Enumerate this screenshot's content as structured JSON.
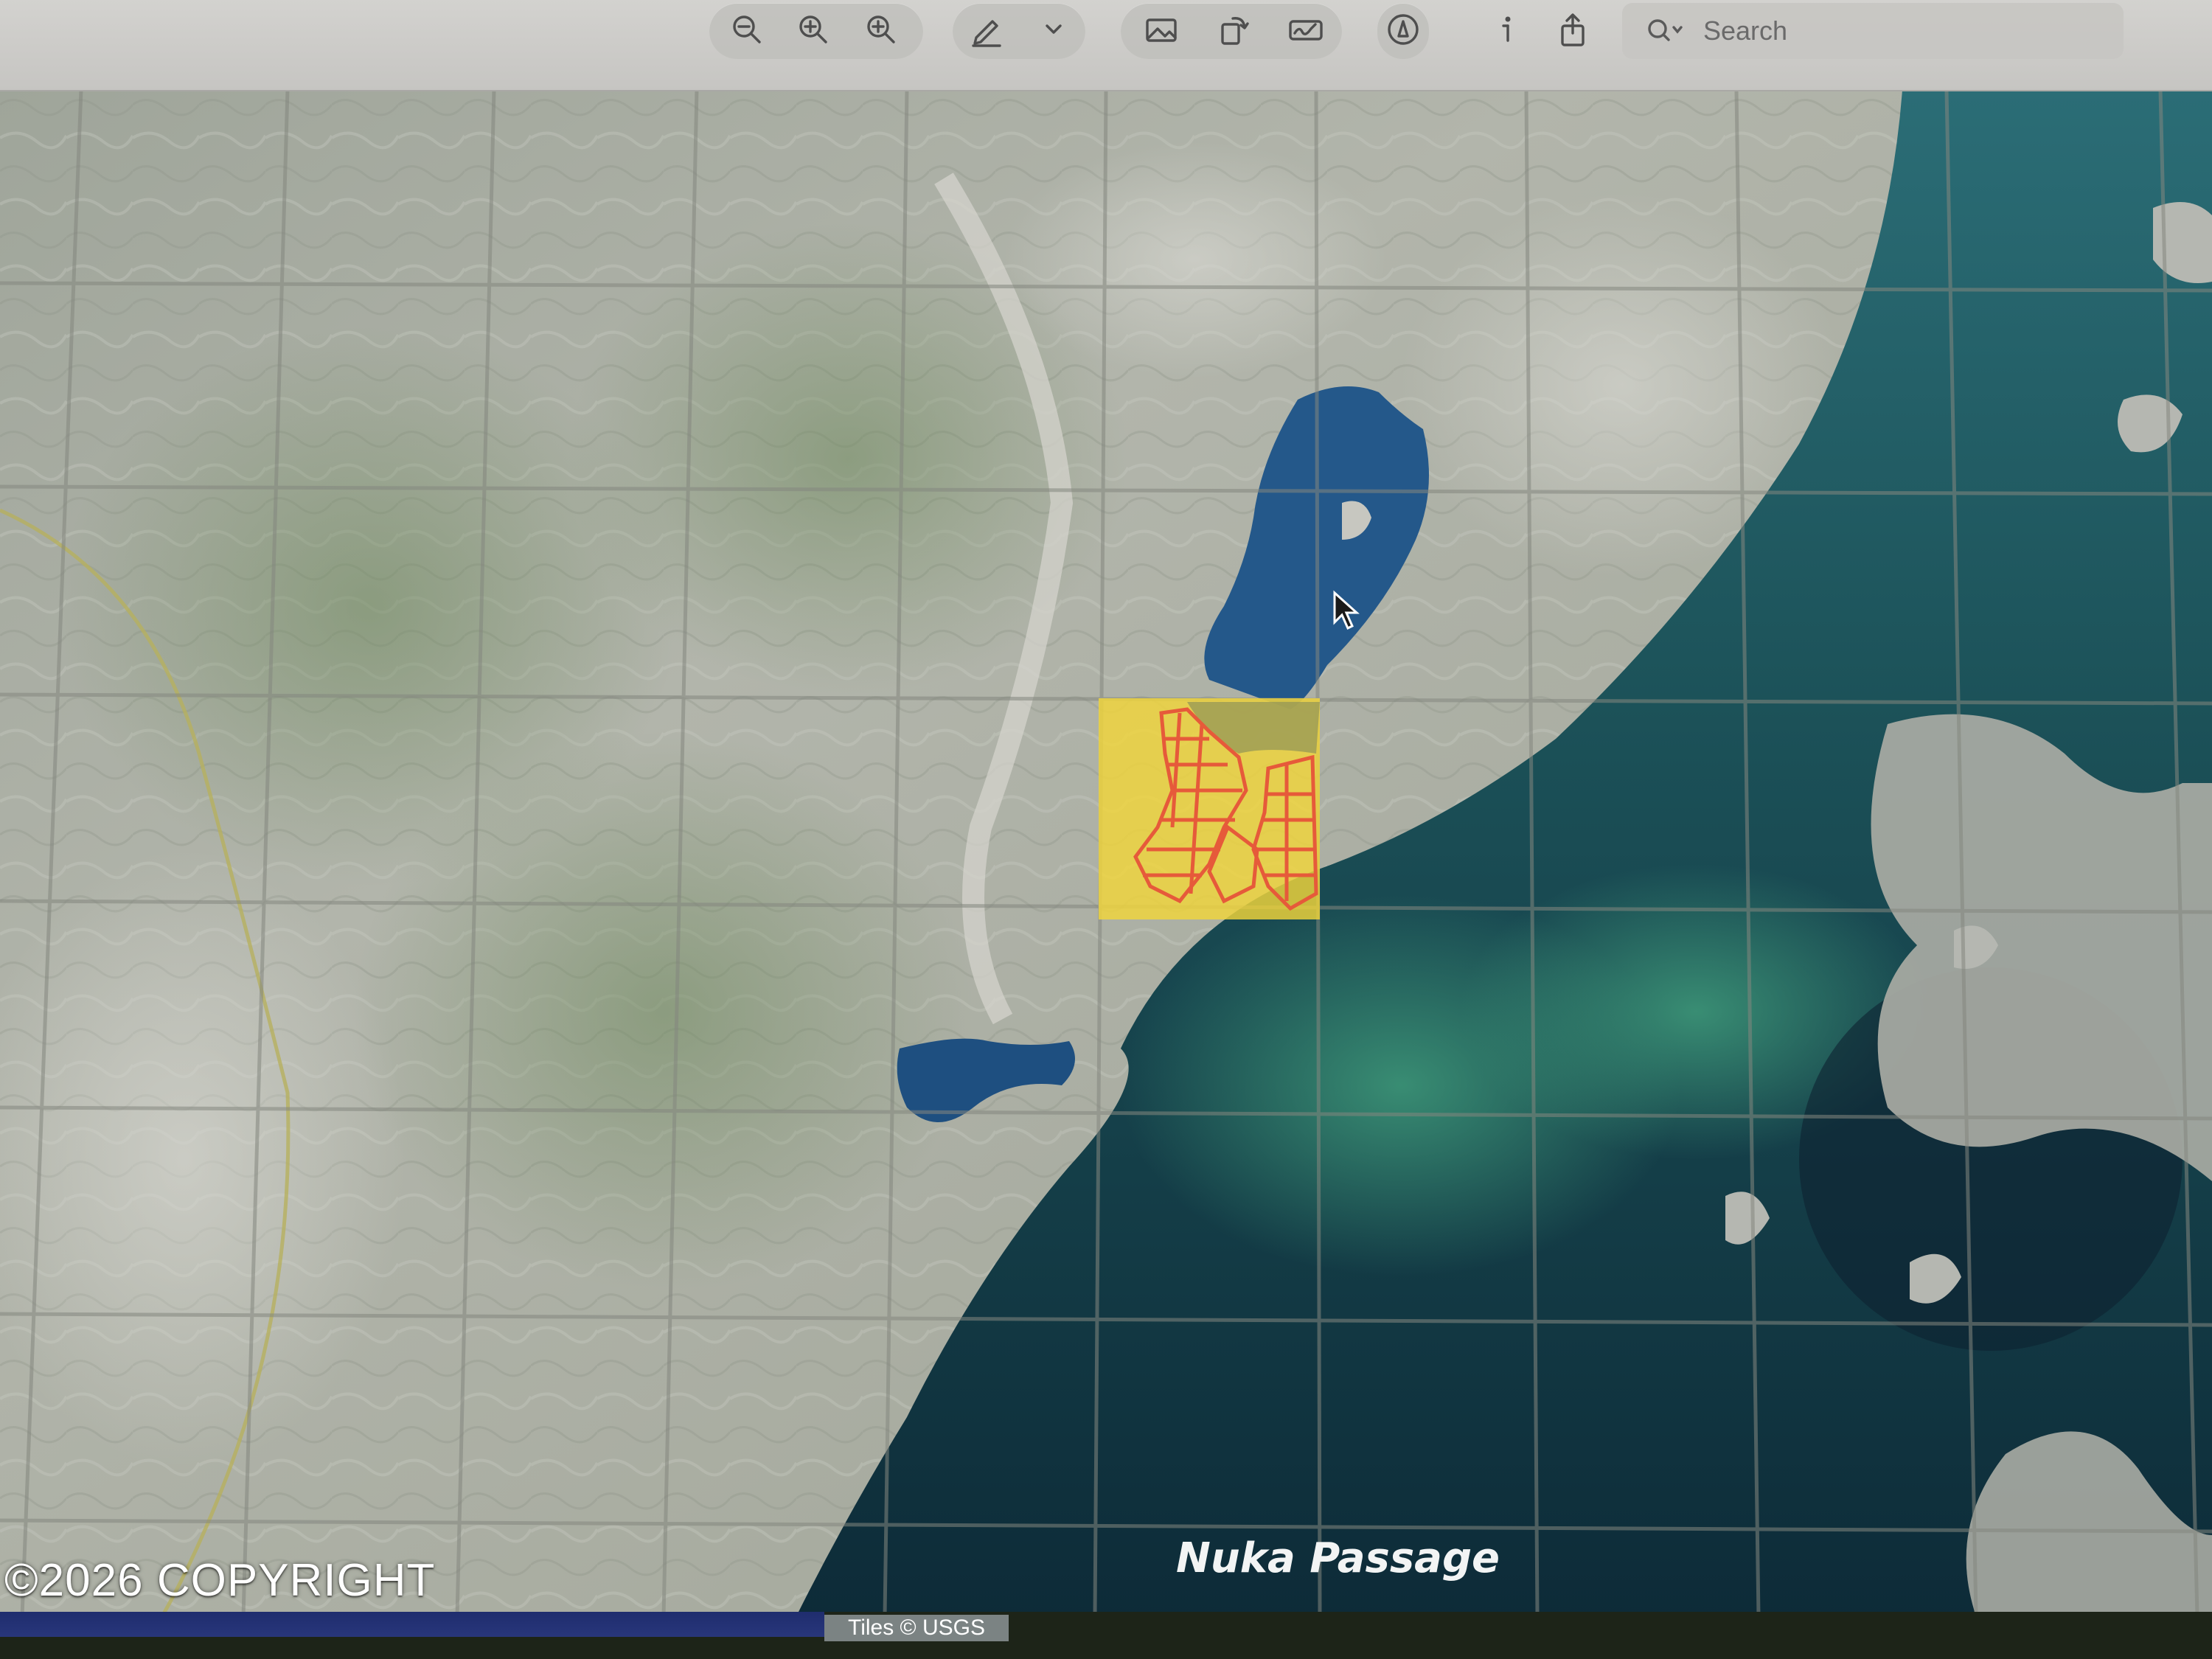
{
  "toolbar": {
    "buttons": [
      {
        "name": "zoom-out-button",
        "icon": "zoom-out-icon"
      },
      {
        "name": "actual-size-button",
        "icon": "actual-size-icon"
      },
      {
        "name": "zoom-in-button",
        "icon": "zoom-in-icon"
      },
      {
        "name": "markup-button",
        "icon": "pencil-icon"
      },
      {
        "name": "markup-menu-button",
        "icon": "chevron-down-icon"
      },
      {
        "name": "image-button",
        "icon": "image-icon"
      },
      {
        "name": "rotate-button",
        "icon": "rotate-icon"
      },
      {
        "name": "signature-button",
        "icon": "signature-icon"
      },
      {
        "name": "annotate-button",
        "icon": "pen-circle-icon"
      },
      {
        "name": "info-button",
        "icon": "info-icon"
      },
      {
        "name": "share-button",
        "icon": "share-icon"
      }
    ],
    "search": {
      "placeholder": "Search",
      "icon": "search-icon"
    }
  },
  "map": {
    "labels": {
      "passage": "Nuka Passage"
    },
    "highlight": {
      "fill": "#f2d63a",
      "stroke": "#e8543a"
    },
    "attribution": "Tiles © USGS"
  },
  "watermark": {
    "copyright": "©2026 COPYRIGHT"
  },
  "colors": {
    "toolbar_bg": "#cbcac7",
    "ocean_deep": "#0f2a3c",
    "ocean_shallow": "#2f7f72",
    "land": "#a9aca3",
    "parcel_outline": "#e65a3a"
  }
}
